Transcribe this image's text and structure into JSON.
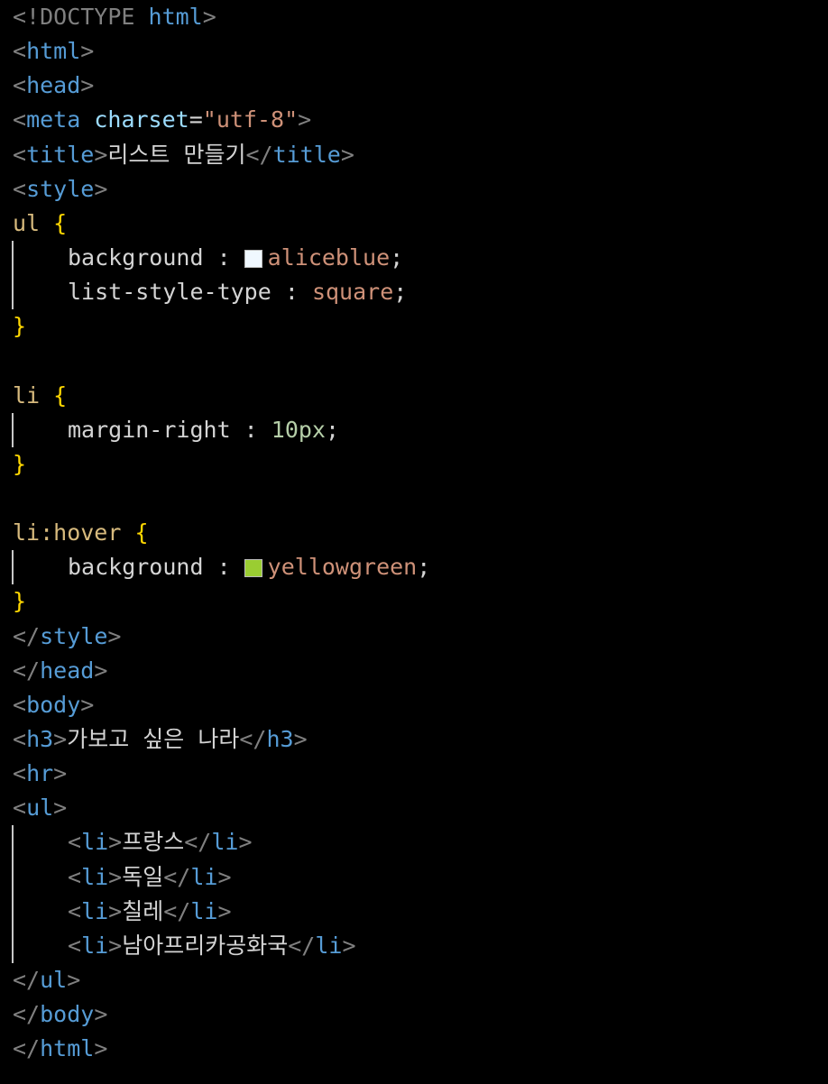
{
  "code": {
    "doctype_open": "<!DOCTYPE",
    "doctype_name": "html",
    "doctype_close": ">",
    "html_tag": "html",
    "head_tag": "head",
    "meta_tag": "meta",
    "meta_attr": "charset",
    "meta_value": "\"utf-8\"",
    "title_tag": "title",
    "title_text": "리스트 만들기",
    "style_tag": "style",
    "rule1_selector": "ul",
    "rule1_prop1": "background",
    "rule1_val1": "aliceblue",
    "rule1_val1_color": "#f0f8ff",
    "rule1_prop2": "list-style-type",
    "rule1_val2": "square",
    "rule2_selector": "li",
    "rule2_prop1": "margin-right",
    "rule2_val1": "10px",
    "rule3_selector": "li:hover",
    "rule3_prop1": "background",
    "rule3_val1": "yellowgreen",
    "rule3_val1_color": "#9acd32",
    "body_tag": "body",
    "h3_tag": "h3",
    "h3_text": "가보고 싶은 나라",
    "hr_tag": "hr",
    "ul_tag": "ul",
    "li_tag": "li",
    "list_items": [
      "프랑스",
      "독일",
      "칠레",
      "남아프리카공화국"
    ]
  },
  "syntax_colors": {
    "background": "#000000",
    "punctuation": "#808080",
    "tag": "#569cd6",
    "attribute": "#9cdcfe",
    "string": "#ce9178",
    "selector": "#d7ba7d",
    "brace": "#ffd700",
    "number": "#b5cea8"
  }
}
